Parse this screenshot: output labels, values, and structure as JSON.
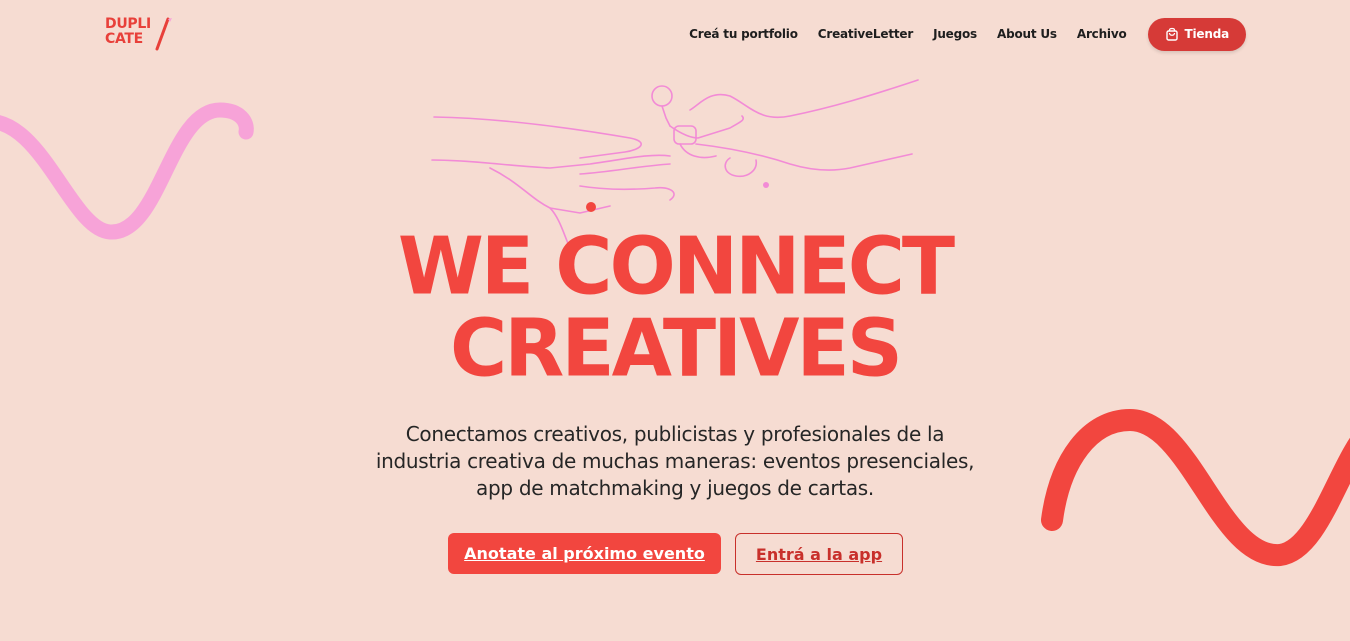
{
  "brand": {
    "line1": "DUPLI",
    "line2": "CATE",
    "color": "#e8403a"
  },
  "nav": {
    "links": [
      "Creá tu portfolio",
      "CreativeLetter",
      "Juegos",
      "About Us",
      "Archivo"
    ],
    "shop_label": "Tienda",
    "shop_icon": "shopping-bag-icon"
  },
  "hero": {
    "title_line1": "WE CONNECT",
    "title_line2": "CREATIVES",
    "lead": "Conectamos creativos, publicistas y profesionales de la industria creativa de muchas maneras: eventos presenciales, app de matchmaking y juegos de cartas.",
    "primary_cta": "Anotate al próximo evento",
    "secondary_cta": "Entrá a la app"
  },
  "colors": {
    "background": "#f6dcd2",
    "accent": "#f2463f",
    "pink": "#f7a3d8"
  }
}
